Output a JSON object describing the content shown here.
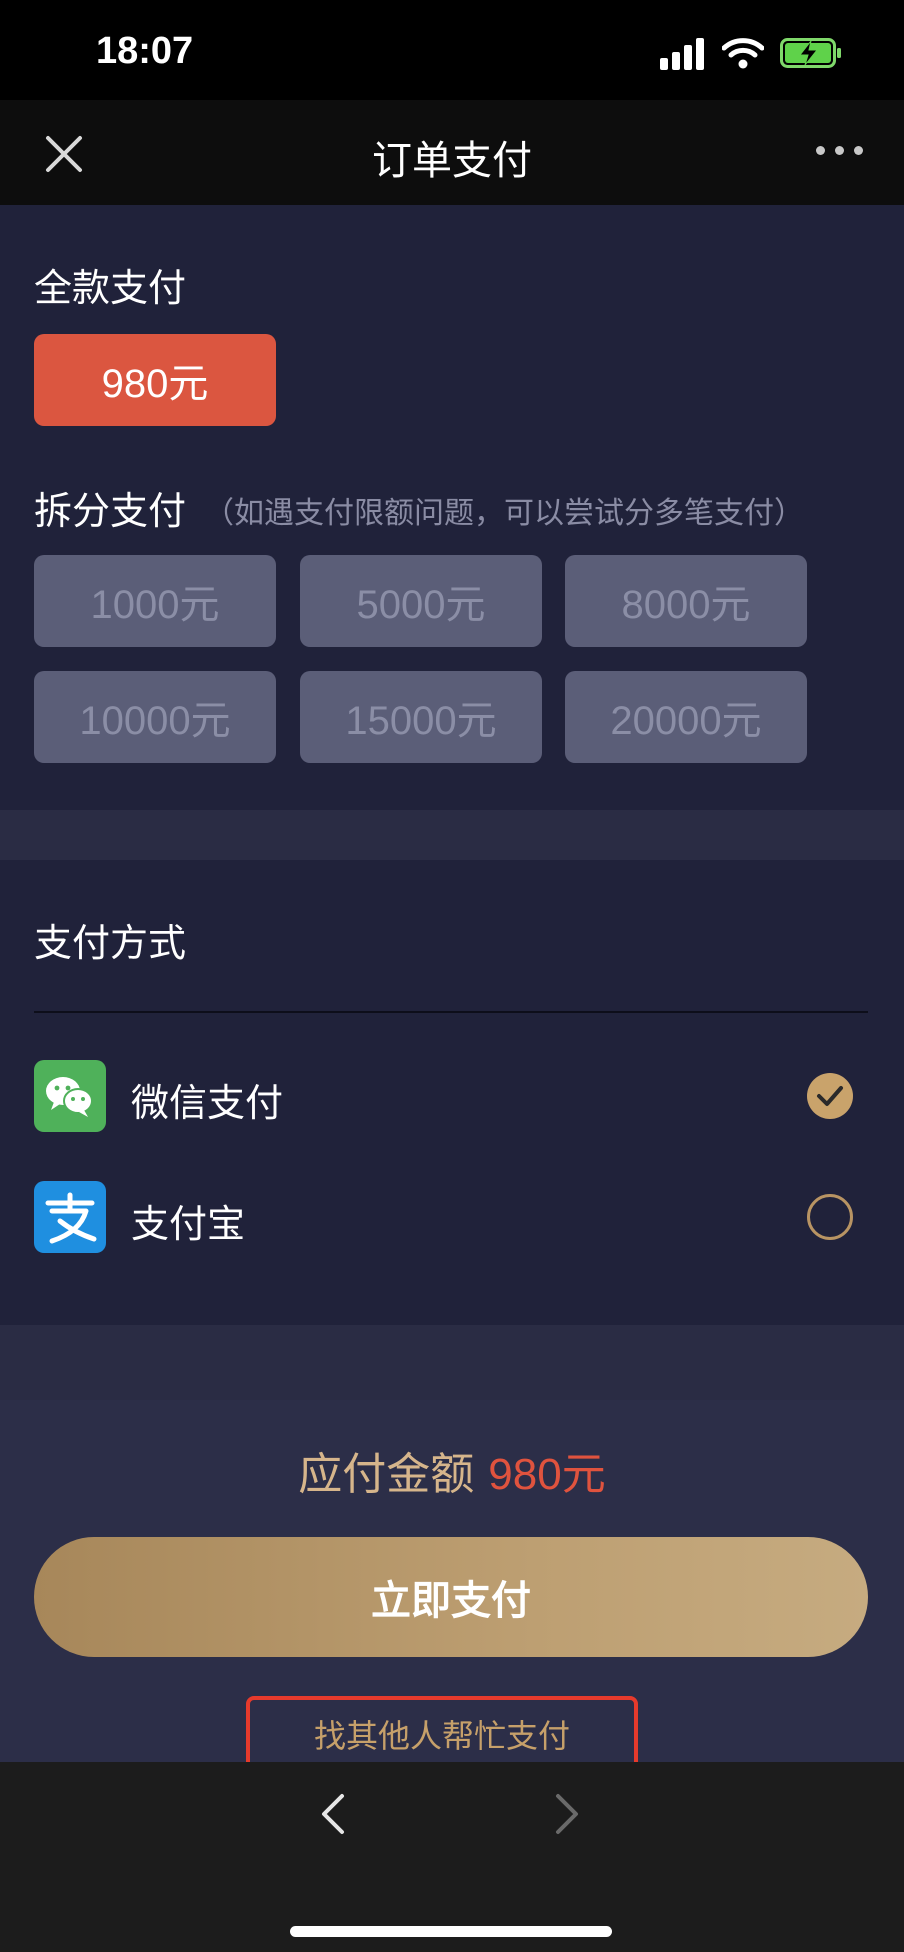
{
  "status": {
    "time": "18:07"
  },
  "nav": {
    "title": "订单支付"
  },
  "full_payment": {
    "label": "全款支付",
    "amount": "980元"
  },
  "split_payment": {
    "label": "拆分支付",
    "note": "（如遇支付限额问题，可以尝试分多笔支付）",
    "options": [
      "1000元",
      "5000元",
      "8000元",
      "10000元",
      "15000元",
      "20000元"
    ]
  },
  "payment_method": {
    "label": "支付方式",
    "methods": [
      {
        "name": "微信支付",
        "icon": "wechat-pay-icon",
        "selected": true
      },
      {
        "name": "支付宝",
        "icon": "alipay-icon",
        "selected": false
      }
    ]
  },
  "summary": {
    "due_label": "应付金额",
    "due_amount": "980元",
    "pay_button": "立即支付",
    "helper_link": "找其他人帮忙支付"
  },
  "colors": {
    "accent_red": "#db5640",
    "gold": "#c9a36b",
    "panel": "#20223a",
    "wechat_green": "#4fb15a",
    "alipay_blue": "#1f8fe0"
  }
}
